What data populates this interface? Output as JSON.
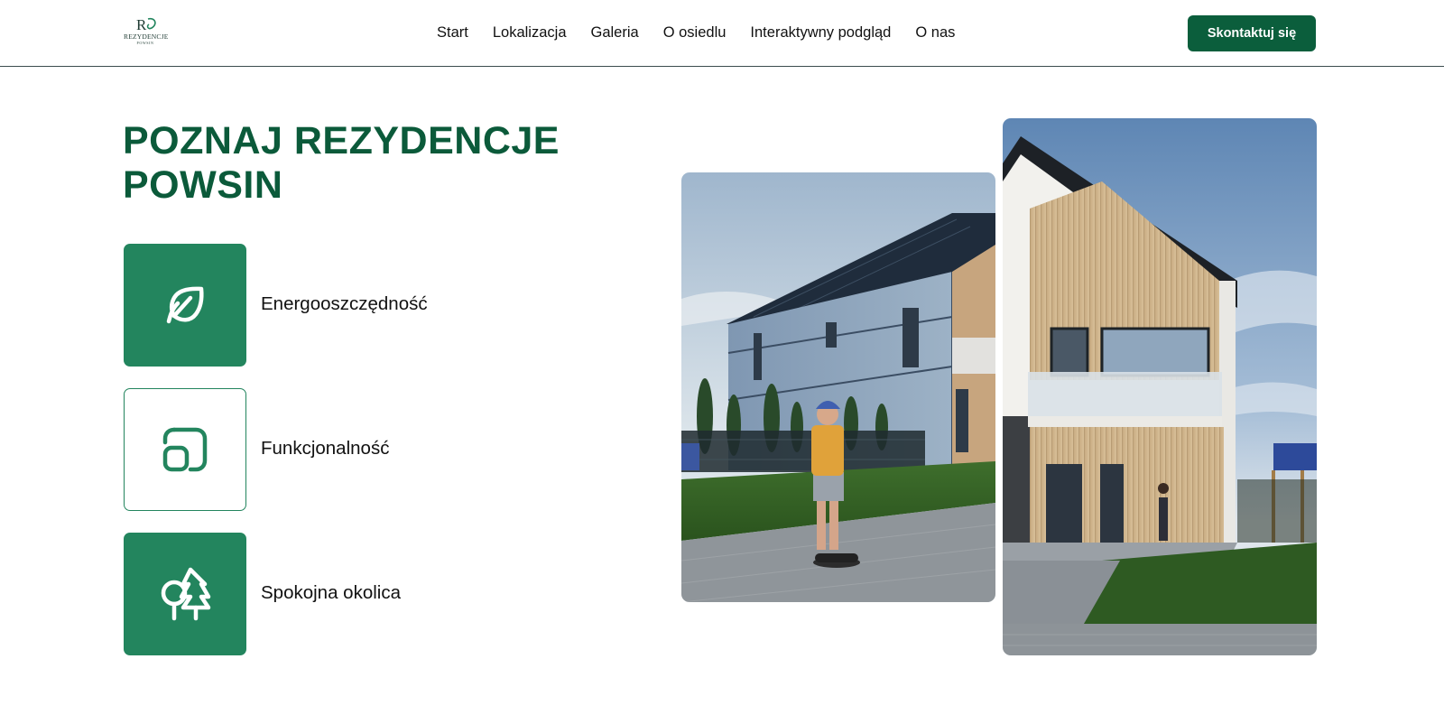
{
  "header": {
    "logo": {
      "monogram": "RP",
      "name": "REZYDENCJE",
      "sub": "POWSIN"
    },
    "nav": [
      "Start",
      "Lokalizacja",
      "Galeria",
      "O osiedlu",
      "Interaktywny podgląd",
      "O nas"
    ],
    "cta_label": "Skontaktuj się"
  },
  "hero": {
    "title_line1": "POZNAJ REZYDENCJE",
    "title_line2": "POWSIN",
    "features": [
      {
        "label": "Energooszczędność",
        "icon": "leaf-icon",
        "style": "filled"
      },
      {
        "label": "Funkcjonalność",
        "icon": "layout-icon",
        "style": "outlined"
      },
      {
        "label": "Spokojna okolica",
        "icon": "trees-icon",
        "style": "filled"
      }
    ]
  },
  "colors": {
    "brand": "#0b5e3c",
    "tile": "#23855e",
    "title": "#0b5a3a"
  }
}
